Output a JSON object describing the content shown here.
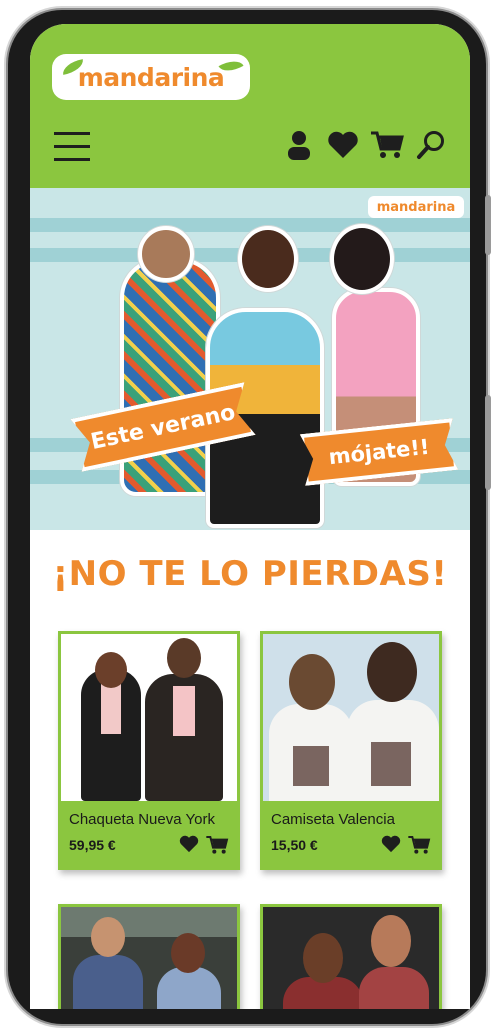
{
  "header": {
    "logo_text": "mandarina",
    "icons": [
      "menu-icon",
      "user-icon",
      "heart-icon",
      "cart-icon",
      "search-icon"
    ]
  },
  "banner": {
    "logo_text": "mandarina",
    "ribbon_left": "Este verano",
    "ribbon_right": "mójate!!"
  },
  "headline": "¡NO TE LO PIERDAS!",
  "products": [
    {
      "name": "Chaqueta Nueva York",
      "price": "59,95 €"
    },
    {
      "name": "Camiseta Valencia",
      "price": "15,50 €"
    },
    {
      "name": "",
      "price": ""
    },
    {
      "name": "",
      "price": ""
    }
  ],
  "colors": {
    "brand_green": "#8bc63f",
    "brand_orange": "#ef8a2d",
    "icon_dark": "#1e1e1e"
  }
}
